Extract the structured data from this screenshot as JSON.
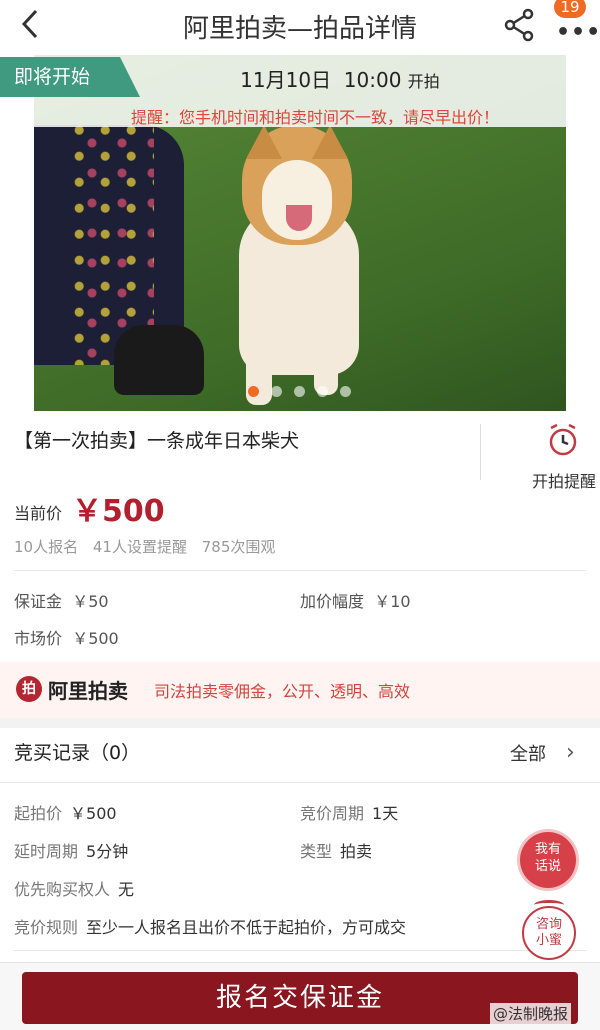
{
  "nav": {
    "title": "阿里拍卖—拍品详情",
    "badge": "19"
  },
  "hero": {
    "status": "即将开始",
    "date": "11月10日",
    "time": "10:00",
    "start_suffix": "开拍",
    "warning": "提醒：您手机时间和拍卖时间不一致，请尽早出价！",
    "pages": 5,
    "current_page": 1
  },
  "item": {
    "title": "【第一次拍卖】一条成年日本柴犬",
    "remind_label": "开拍提醒",
    "price_label": "当前价",
    "price": "￥500",
    "stats": [
      "10人报名",
      "41人设置提醒",
      "785次围观"
    ]
  },
  "fees": {
    "deposit_label": "保证金",
    "deposit": "￥50",
    "increment_label": "加价幅度",
    "increment": "￥10",
    "market_label": "市场价",
    "market": "￥500"
  },
  "banner": {
    "logo_text": "阿里拍卖",
    "slogan": "司法拍卖零佣金，公开、透明、高效"
  },
  "records": {
    "title": "竞买记录（0）",
    "all": "全部"
  },
  "details": {
    "start_price_label": "起拍价",
    "start_price": "￥500",
    "cycle_label": "竞价周期",
    "cycle": "1天",
    "delay_label": "延时周期",
    "delay": "5分钟",
    "type_label": "类型",
    "type": "拍卖",
    "priority_label": "优先购买权人",
    "priority": "无",
    "rule_label": "竞价规则",
    "rule": "至少一人报名且出价不低于起拍价，方可成交"
  },
  "fab": {
    "service_line1": "我有",
    "service_line2": "话说",
    "advisor_line1": "咨询",
    "advisor_line2": "小蜜"
  },
  "cta": {
    "label": "报名交保证金"
  },
  "watermark": "@法制晚报",
  "colors": {
    "price": "#b21f2d",
    "status_tag": "#3f9a80",
    "cta": "#8a1620",
    "warning": "#e0443a",
    "accent": "#f06a24"
  }
}
